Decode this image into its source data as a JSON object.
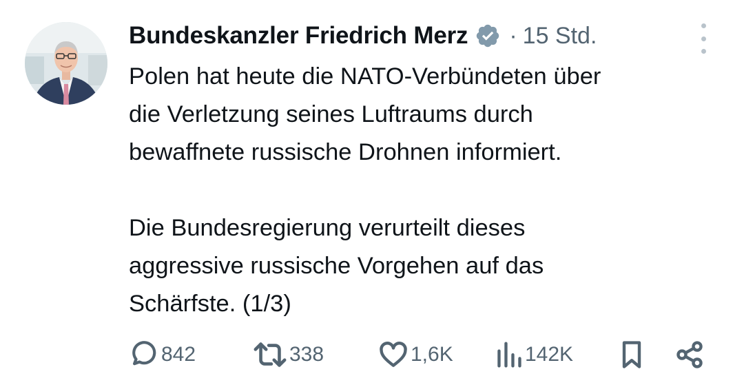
{
  "author": {
    "name": "Bundeskanzler Friedrich Merz",
    "verified_icon": "verified-badge-icon",
    "separator": "·",
    "time": "15 Std."
  },
  "tweet": {
    "paragraph1_lines": [
      "Polen hat heute die NATO-Verbündeten über",
      "die Verletzung seines Luftraums durch",
      "bewaffnete russische Drohnen informiert."
    ],
    "paragraph2_lines": [
      "Die Bundesregierung verurteilt dieses",
      "aggressive russische Vorgehen auf das",
      "Schärfste. (1/3)"
    ]
  },
  "actions": {
    "replies": "842",
    "reposts": "338",
    "likes": "1,6K",
    "views": "142K"
  },
  "colors": {
    "text": "#0f1419",
    "secondary": "#536471",
    "verified": "#829aab"
  }
}
